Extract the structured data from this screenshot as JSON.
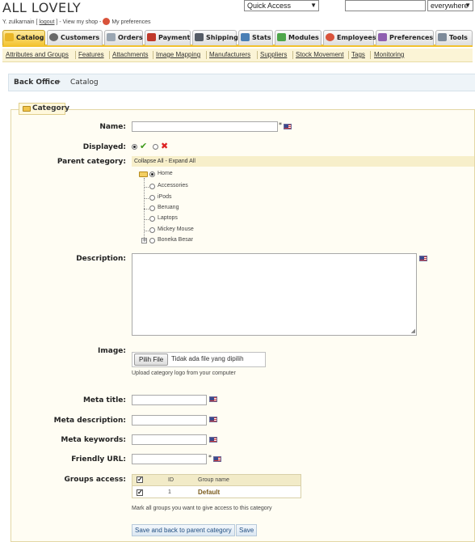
{
  "header": {
    "shop_name": "ALL LOVELY",
    "user_name": "Y. zulkarnain",
    "logout": "logout",
    "view_shop": "View my shop",
    "my_preferences": "My preferences",
    "quick_access": "Quick Access",
    "search_value": "",
    "search_scope": "everywhere"
  },
  "tabs": [
    {
      "label": "Catalog",
      "icon": "catalog-icon",
      "active": true
    },
    {
      "label": "Customers",
      "icon": "customers-icon"
    },
    {
      "label": "Orders",
      "icon": "orders-icon"
    },
    {
      "label": "Payment",
      "icon": "payment-icon"
    },
    {
      "label": "Shipping",
      "icon": "shipping-icon"
    },
    {
      "label": "Stats",
      "icon": "stats-icon"
    },
    {
      "label": "Modules",
      "icon": "modules-icon"
    },
    {
      "label": "Employees",
      "icon": "employees-icon"
    },
    {
      "label": "Preferences",
      "icon": "preferences-icon"
    },
    {
      "label": "Tools",
      "icon": "tools-icon"
    }
  ],
  "subnav": [
    "Attributes and Groups",
    "Features",
    "Attachments",
    "Image Mapping",
    "Manufacturers",
    "Suppliers",
    "Stock Movement",
    "Tags",
    "Monitoring"
  ],
  "breadcrumb": {
    "root": "Back Office",
    "current": "Catalog"
  },
  "form": {
    "legend": "Category",
    "name_label": "Name:",
    "name_value": "",
    "required_mark": "*",
    "displayed_label": "Displayed:",
    "displayed_value": "yes",
    "parent_label": "Parent category:",
    "tree_controls": "Collapse All - Expand All",
    "tree_root": "Home",
    "tree_children": [
      "Accessories",
      "iPods",
      "Beruang",
      "Laptops",
      "Mickey Mouse",
      "Boneka Besar"
    ],
    "description_label": "Description:",
    "image_label": "Image:",
    "file_button": "Pilih File",
    "file_status": "Tidak ada file yang dipilih",
    "image_hint": "Upload category logo from your computer",
    "meta_title_label": "Meta title:",
    "meta_description_label": "Meta description:",
    "meta_keywords_label": "Meta keywords:",
    "friendly_url_label": "Friendly URL:",
    "groups_label": "Groups access:",
    "groups_columns": {
      "id": "ID",
      "name": "Group name"
    },
    "groups_rows": [
      {
        "checked": true,
        "id": "1",
        "name": "Default"
      }
    ],
    "groups_hint": "Mark all groups you want to give access to this category",
    "save_back_button": "Save and back to parent category",
    "save_button": "Save"
  },
  "colors": {
    "tab_accent": "#f2c22e",
    "button_text": "#1f4d80"
  }
}
